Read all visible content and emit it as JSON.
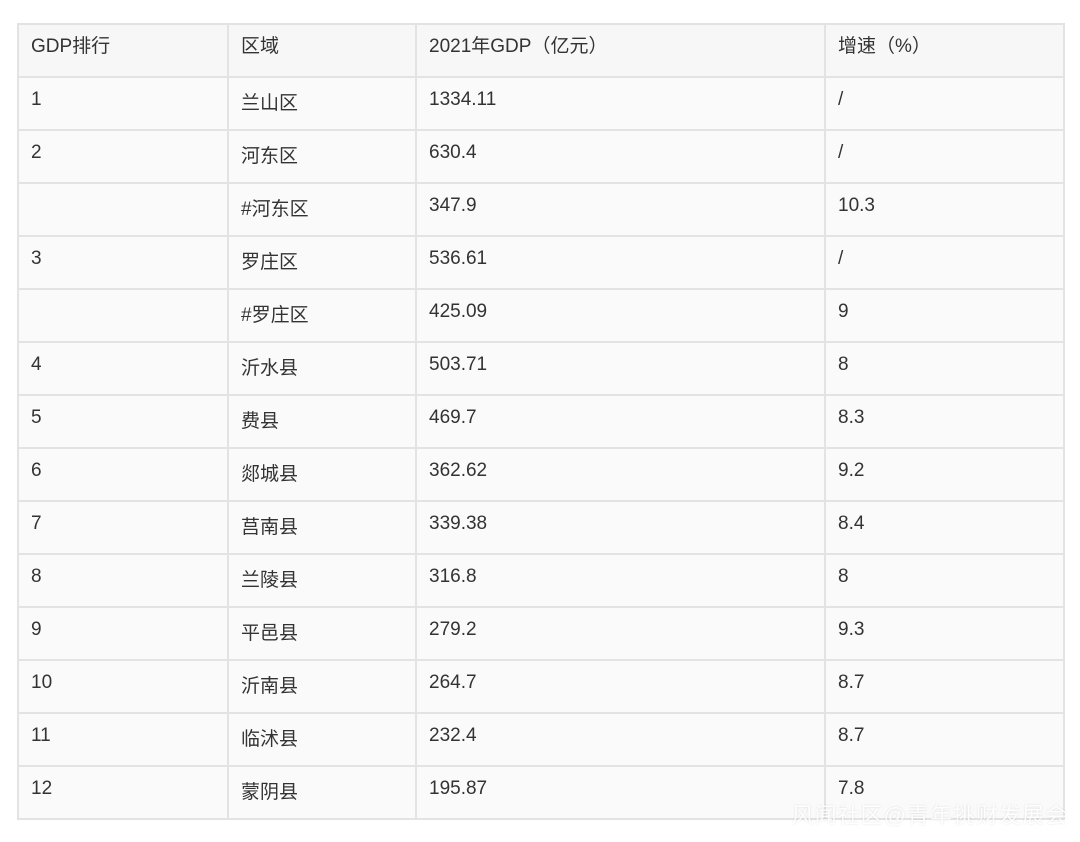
{
  "table": {
    "headers": [
      "GDP排行",
      "区域",
      "2021年GDP（亿元）",
      "增速（%）"
    ],
    "rows": [
      {
        "rank": "1",
        "region": "兰山区",
        "gdp": "1334.11",
        "growth": "/"
      },
      {
        "rank": "2",
        "region": "河东区",
        "gdp": "630.4",
        "growth": "/"
      },
      {
        "rank": "",
        "region": "#河东区",
        "gdp": "347.9",
        "growth": "10.3"
      },
      {
        "rank": "3",
        "region": "罗庄区",
        "gdp": "536.61",
        "growth": "/"
      },
      {
        "rank": "",
        "region": "#罗庄区",
        "gdp": "425.09",
        "growth": "9"
      },
      {
        "rank": "4",
        "region": "沂水县",
        "gdp": "503.71",
        "growth": "8"
      },
      {
        "rank": "5",
        "region": "费县",
        "gdp": "469.7",
        "growth": "8.3"
      },
      {
        "rank": "6",
        "region": "郯城县",
        "gdp": "362.62",
        "growth": "9.2"
      },
      {
        "rank": "7",
        "region": "莒南县",
        "gdp": "339.38",
        "growth": "8.4"
      },
      {
        "rank": "8",
        "region": "兰陵县",
        "gdp": "316.8",
        "growth": "8"
      },
      {
        "rank": "9",
        "region": "平邑县",
        "gdp": "279.2",
        "growth": "9.3"
      },
      {
        "rank": "10",
        "region": "沂南县",
        "gdp": "264.7",
        "growth": "8.7"
      },
      {
        "rank": "11",
        "region": "临沭县",
        "gdp": "232.4",
        "growth": "8.7"
      },
      {
        "rank": "12",
        "region": "蒙阴县",
        "gdp": "195.87",
        "growth": "7.8"
      }
    ]
  },
  "watermark": "风闻社区@青年挑财发展会"
}
